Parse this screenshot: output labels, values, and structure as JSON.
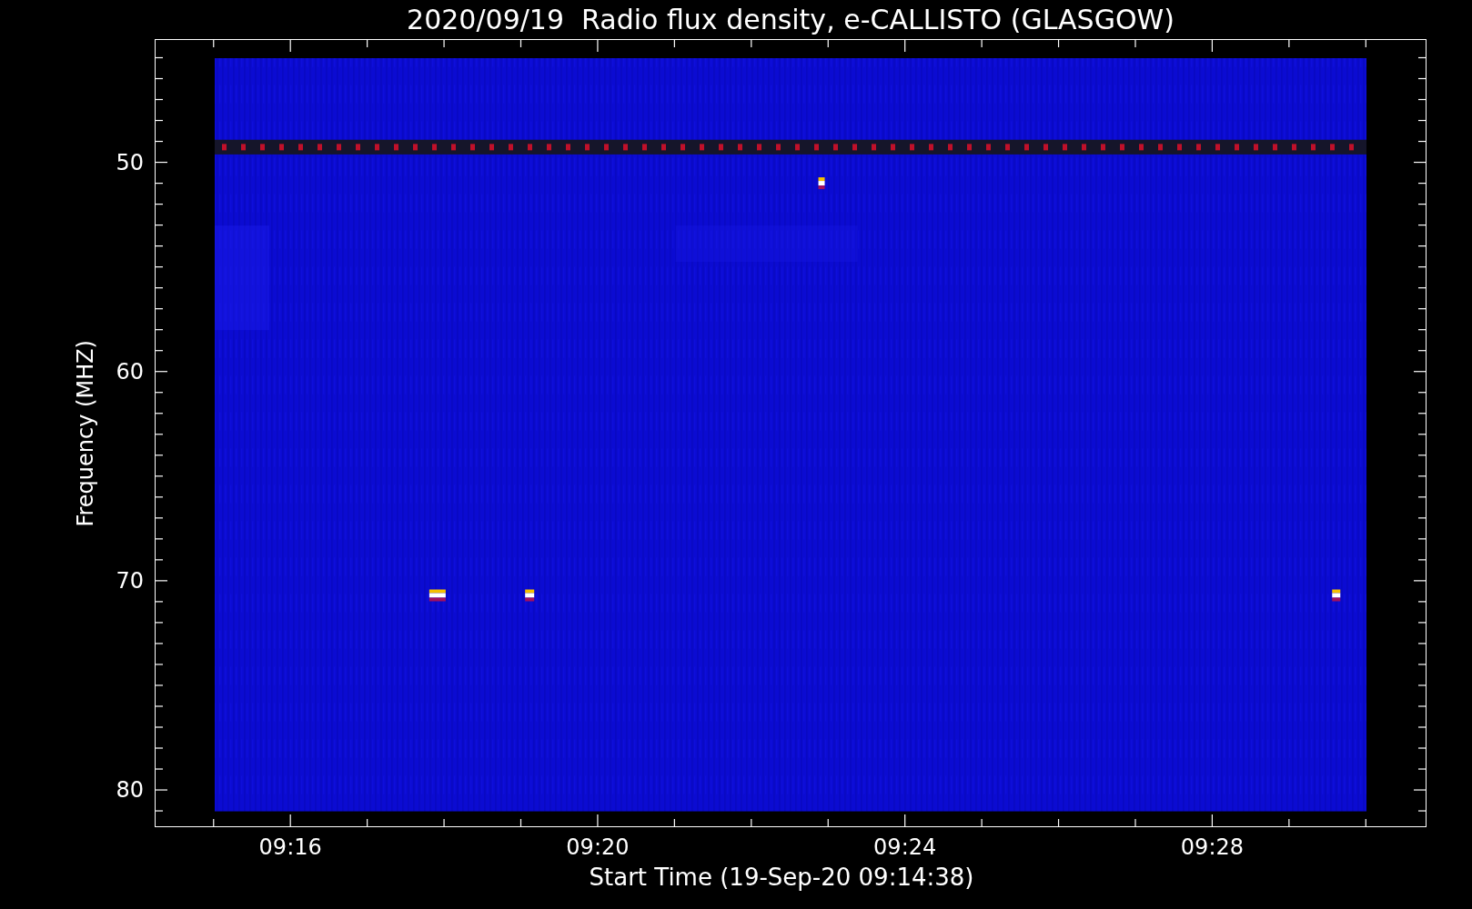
{
  "title": "2020/09/19  Radio flux density, e-CALLISTO (GLASGOW)",
  "y_axis": {
    "label": "Frequency (MHZ)",
    "ticks": [
      "50",
      "60",
      "70",
      "80"
    ]
  },
  "x_axis": {
    "label": "Start Time (19-Sep-20 09:14:38)",
    "ticks": [
      "09:16",
      "09:20",
      "09:24",
      "09:28"
    ]
  }
}
